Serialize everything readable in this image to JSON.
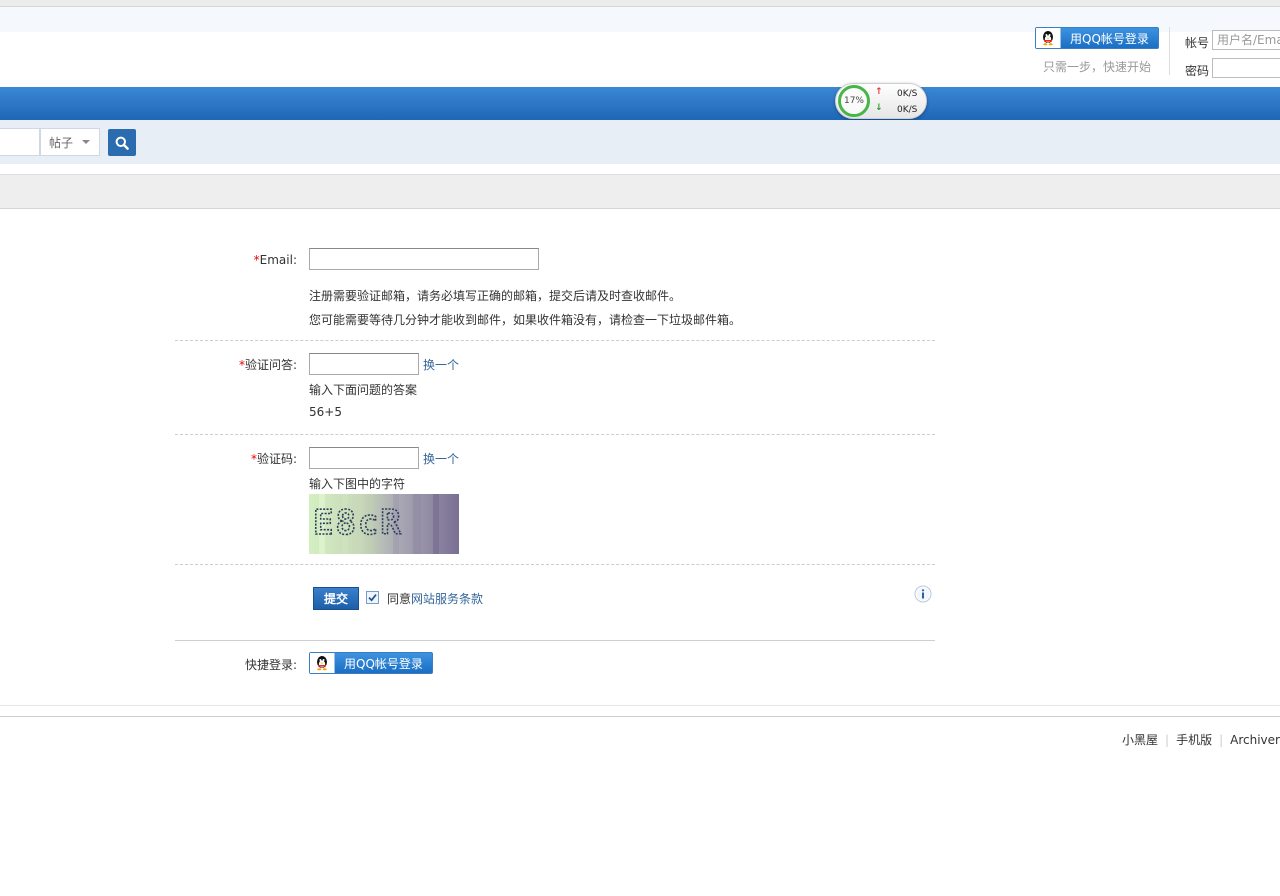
{
  "header": {
    "qq_login_label": "用QQ帐号登录",
    "tagline": "只需一步，快速开始",
    "account_label": "帐号",
    "account_placeholder": "用户名/Email",
    "password_label": "密码"
  },
  "speed_widget": {
    "percent": "17%",
    "upload": "0K/S",
    "download": "0K/S",
    "up_arrow": "↑",
    "down_arrow": "↓"
  },
  "search": {
    "type_selected": "帖子"
  },
  "form": {
    "required_mark": "*",
    "email_label": "Email:",
    "email_note_1": "注册需要验证邮箱，请务必填写正确的邮箱，提交后请及时查收邮件。",
    "email_note_2": "您可能需要等待几分钟才能收到邮件，如果收件箱没有，请检查一下垃圾邮件箱。",
    "question_label": "验证问答:",
    "change_label": "换一个",
    "question_note": "输入下面问题的答案",
    "question_text": "56+5",
    "code_label": "验证码:",
    "code_note": "输入下图中的字符",
    "captcha_text": "E8cR",
    "submit_label": "提交",
    "agree_prefix": "同意",
    "terms_link": "网站服务条款",
    "agree_checked": true,
    "quick_login_label": "快捷登录:",
    "quick_qq_label": "用QQ帐号登录"
  },
  "footer": {
    "links": [
      "小黑屋",
      "手机版",
      "Archiver"
    ]
  },
  "colors": {
    "nav_blue": "#1e66b6",
    "search_strip": "#e8eef5",
    "link": "#336699",
    "required": "#e00000"
  }
}
